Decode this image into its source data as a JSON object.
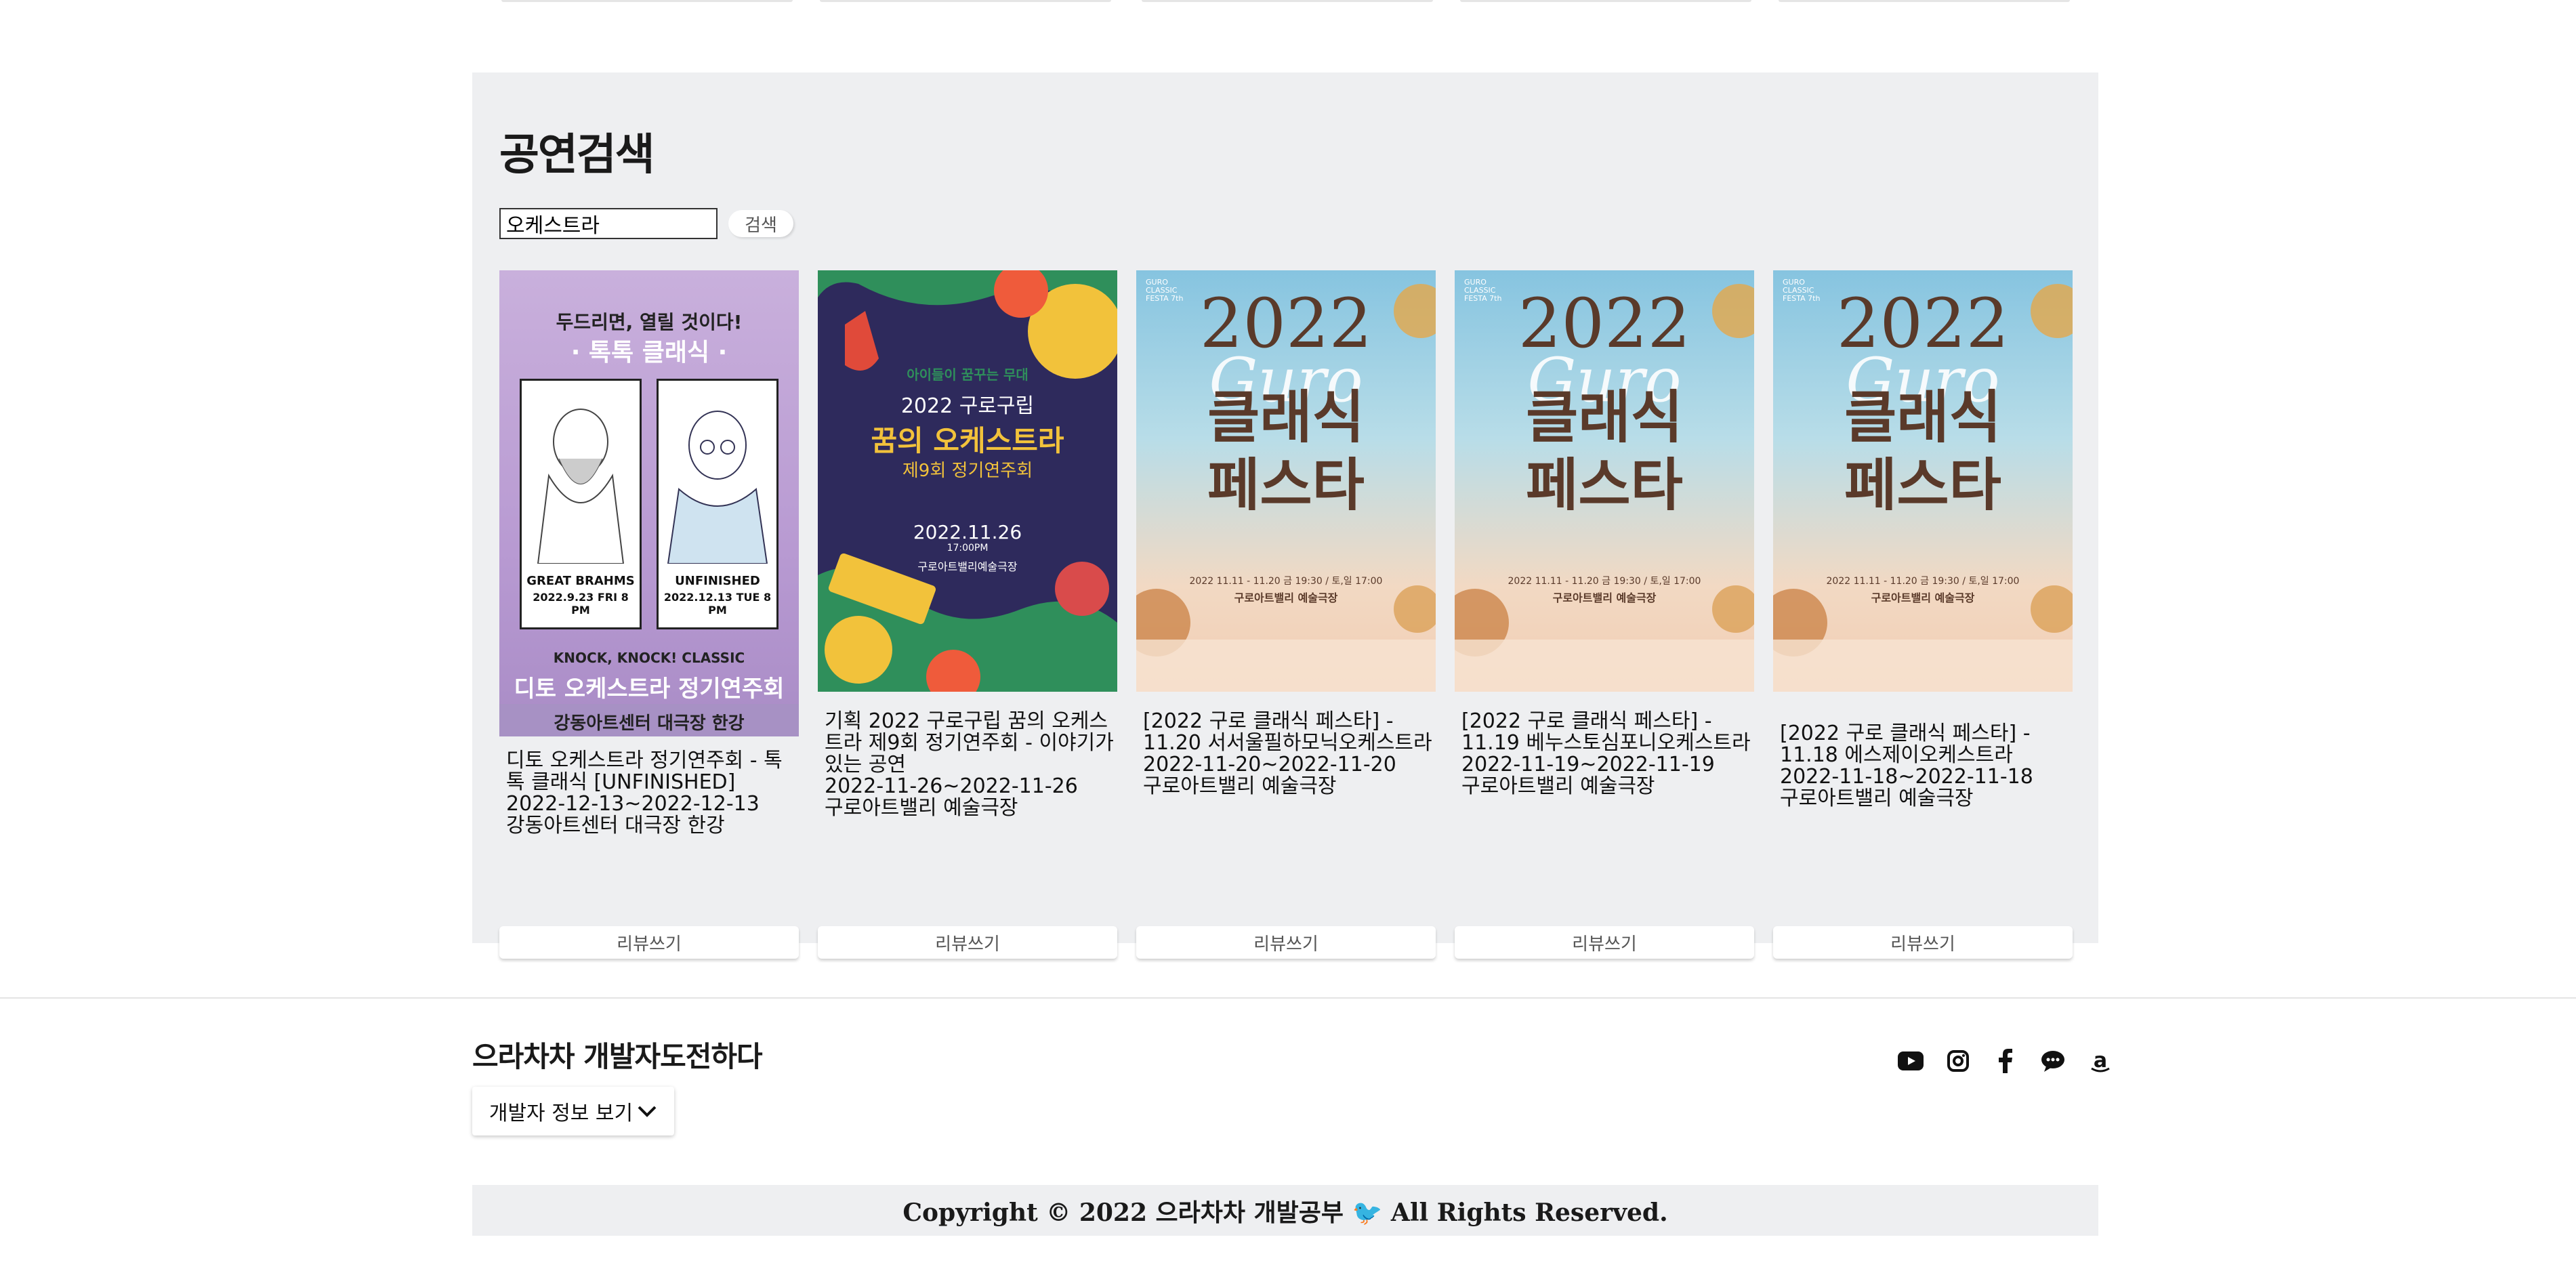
{
  "search_section": {
    "title": "공연검색",
    "search_value": "오케스트라",
    "search_button": "검색",
    "results": [
      {
        "poster": {
          "top_text": "두드리면, 열릴 것이다!",
          "subtitle": "· 톡톡 클래식 ·",
          "left_name": "GREAT BRAHMS",
          "left_date": "2022.9.23 FRI 8 PM",
          "right_name": "UNFINISHED",
          "right_date": "2022.12.13 TUE 8 PM",
          "series": "KNOCK, KNOCK! CLASSIC",
          "main": "디토 오케스트라 정기연주회",
          "venue": "강동아트센터 대극장 한강"
        },
        "lines": [
          "디토 오케스트라 정기연주회 - 톡톡 클래식 [UNFINISHED]",
          "2022-12-13~2022-12-13",
          "강동아트센터 대극장 한강"
        ],
        "review_button": "리뷰쓰기"
      },
      {
        "poster": {
          "small": "아이들이 꿈꾸는 무대",
          "line1": "2022 구로구립",
          "main": "꿈의 오케스트라",
          "sub": "제9회 정기연주회",
          "date": "2022.11.26",
          "time": "17:00PM",
          "venue": "구로아트밸리예술극장"
        },
        "lines": [
          "기획 2022 구로구립 꿈의 오케스트라 제9회 정기연주회 - 이야기가 있는 공연",
          "2022-11-26~2022-11-26",
          "구로아트밸리 예술극장"
        ],
        "review_button": "리뷰쓰기"
      },
      {
        "poster": {
          "corner": "GURO CLASSIC FESTA 7th",
          "year": "2022",
          "script": "Guro",
          "title1": "클래식",
          "title2": "페스타",
          "dates": "2022 11.11 - 11.20 금 19:30 / 토,일 17:00",
          "venue": "구로아트밸리 예술극장"
        },
        "lines": [
          "[2022 구로 클래식 페스타] - 11.20 서서울필하모닉오케스트라",
          "2022-11-20~2022-11-20",
          "구로아트밸리 예술극장"
        ],
        "review_button": "리뷰쓰기"
      },
      {
        "poster": {
          "corner": "GURO CLASSIC FESTA 7th",
          "year": "2022",
          "script": "Guro",
          "title1": "클래식",
          "title2": "페스타",
          "dates": "2022 11.11 - 11.20 금 19:30 / 토,일 17:00",
          "venue": "구로아트밸리 예술극장"
        },
        "lines": [
          "[2022 구로 클래식 페스타] - 11.19 베누스토심포니오케스트라",
          "2022-11-19~2022-11-19",
          "구로아트밸리 예술극장"
        ],
        "review_button": "리뷰쓰기"
      },
      {
        "poster": {
          "corner": "GURO CLASSIC FESTA 7th",
          "year": "2022",
          "script": "Guro",
          "title1": "클래식",
          "title2": "페스타",
          "dates": "2022 11.11 - 11.20 금 19:30 / 토,일 17:00",
          "venue": "구로아트밸리 예술극장"
        },
        "lines": [
          "[2022 구로 클래식 페스타] - 11.18 에스제이오케스트라",
          "2022-11-18~2022-11-18",
          "구로아트밸리 예술극장"
        ],
        "review_button": "리뷰쓰기"
      }
    ]
  },
  "footer": {
    "brand": "으라차차 개발자도전하다",
    "dev_info_button": "개발자 정보 보기",
    "social_icons": [
      "youtube-icon",
      "instagram-icon",
      "facebook-icon",
      "chat-icon",
      "amazon-icon"
    ],
    "copyright": "Copyright © 2022 으라차차 개발공부 🐦 All Rights Reserved."
  }
}
